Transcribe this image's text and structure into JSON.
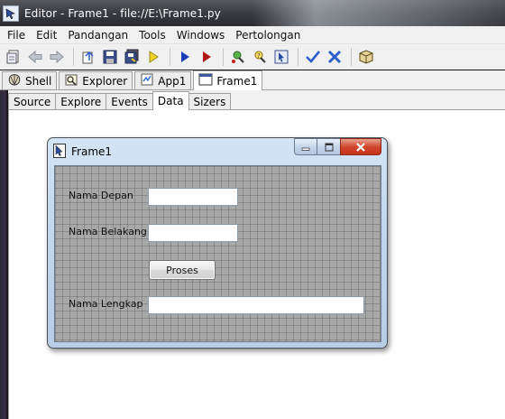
{
  "window": {
    "title": "Editor - Frame1 - file://E:\\Frame1.py"
  },
  "menu": {
    "items": [
      "File",
      "Edit",
      "Pandangan",
      "Tools",
      "Windows",
      "Pertolongan"
    ]
  },
  "toolbar": {
    "buttons": [
      "new-file-icon",
      "back-arrow-icon",
      "forward-arrow-icon",
      "open-folder-icon",
      "save-icon",
      "save-all-icon",
      "run-icon",
      "debug-run-icon",
      "stop-icon",
      "inspect-icon",
      "find-icon",
      "help-icon",
      "check-icon",
      "cancel-icon",
      "book-icon"
    ]
  },
  "main_tabs": [
    {
      "label": "Shell",
      "icon": "shell-icon"
    },
    {
      "label": "Explorer",
      "icon": "explorer-icon"
    },
    {
      "label": "App1",
      "icon": "app-icon"
    },
    {
      "label": "Frame1",
      "icon": "frame-icon"
    }
  ],
  "sub_tabs": [
    "Source",
    "Explore",
    "Events",
    "Data",
    "Sizers"
  ],
  "active_main_tab": "Frame1",
  "active_sub_tab": "Data",
  "frame": {
    "title": "Frame1",
    "labels": {
      "first_name": "Nama Depan",
      "last_name": "Nama Belakang",
      "full_name": "Nama Lengkap"
    },
    "fields": {
      "first_name_value": "",
      "last_name_value": "",
      "full_name_value": ""
    },
    "process_button": "Proses"
  },
  "colors": {
    "titlebar": "#3a3b40",
    "designer_grid": "#a8a8a8",
    "close_button": "#d1472c",
    "run_icon": "#1f3fb8",
    "stop_icon": "#b01818",
    "check_icon": "#2a5fc8"
  }
}
